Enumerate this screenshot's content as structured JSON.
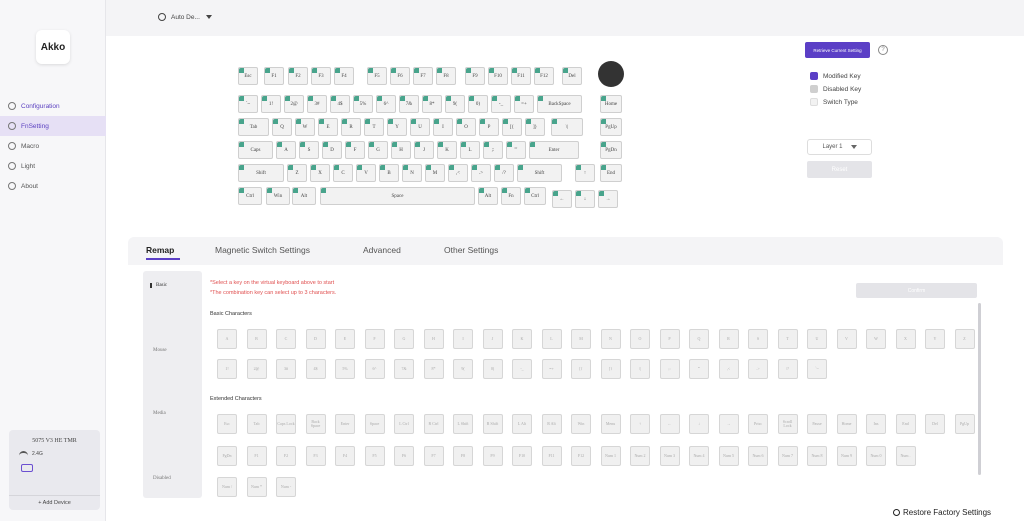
{
  "brand": "Akko",
  "mode_selector": "Auto De...",
  "nav": [
    {
      "label": "Configuration",
      "icon": "gear-icon",
      "active": false
    },
    {
      "label": "FnSetting",
      "icon": "fn-icon",
      "active": true
    },
    {
      "label": "Macro",
      "icon": "macro-icon",
      "active": false
    },
    {
      "label": "Light",
      "icon": "light-icon",
      "active": false
    },
    {
      "label": "About",
      "icon": "info-icon",
      "active": false
    }
  ],
  "device": {
    "name": "5075 V3 HE TMR",
    "connection": "2.4G",
    "add_label": "+ Add Device"
  },
  "retrieve_label": "Retrieve Current Setting",
  "help_label": "?",
  "legend": [
    {
      "label": "Modified Key",
      "color": "#5b3fc6"
    },
    {
      "label": "Disabled Key",
      "color": "#cfcfcf"
    },
    {
      "label": "Switch Type",
      "color": "#f2f2f2"
    }
  ],
  "layer": "Layer 1",
  "reset_label": "Reset",
  "tabs": [
    "Remap",
    "Magnetic Switch Settings",
    "Advanced",
    "Other Settings"
  ],
  "subnav": [
    "Basic",
    "Mouse",
    "Media",
    "Disabled"
  ],
  "hints": [
    "*Select a key on the virtual keyboard above to start",
    "*The combination key can select up to 3 characters."
  ],
  "confirm_label": "Confirm",
  "sections": {
    "basic": "Basic Characters",
    "extended": "Extended Characters"
  },
  "basic_keys_row1": [
    "A",
    "B",
    "C",
    "D",
    "E",
    "F",
    "G",
    "H",
    "I",
    "J",
    "K",
    "L",
    "M",
    "N",
    "O",
    "P",
    "Q",
    "R",
    "S",
    "T",
    "U",
    "V",
    "W",
    "X",
    "Y",
    "Z"
  ],
  "basic_keys_row2": [
    "1!",
    "2@",
    "3#",
    "4$",
    "5%",
    "6^",
    "7&",
    "8*",
    "9(",
    "0)",
    "-_",
    "=+",
    "[{",
    "]}",
    "\\|",
    ";:",
    "'\"",
    ",<",
    ".>",
    "/?",
    "`~"
  ],
  "extended_row1": [
    "Esc",
    "Tab",
    "Caps Lock",
    "Back Space",
    "Enter",
    "Space",
    "L Ctrl",
    "R Ctrl",
    "L Shift",
    "R Shift",
    "L Alt",
    "R Alt",
    "Win",
    "Menu",
    "↑",
    "←",
    "↓",
    "→",
    "Prtsc",
    "Scroll Lock",
    "Pause",
    "Home",
    "Ins",
    "End",
    "Del",
    "PgUp"
  ],
  "extended_row2": [
    "PgDn",
    "F1",
    "F2",
    "F3",
    "F4",
    "F5",
    "F6",
    "F7",
    "F8",
    "F9",
    "F10",
    "F11",
    "F12",
    "Num 1",
    "Num 2",
    "Num 3",
    "Num 4",
    "Num 5",
    "Num 6",
    "Num 7",
    "Num 8",
    "Num 9",
    "Num 0",
    "Num ."
  ],
  "extended_row3": [
    "Num /",
    "Num *",
    "Num -"
  ],
  "keyboard": {
    "row0": [
      "Esc",
      "F1",
      "F2",
      "F3",
      "F4",
      "F5",
      "F6",
      "F7",
      "F8",
      "F9",
      "F10",
      "F11",
      "F12",
      "Del"
    ],
    "row1": [
      "`~",
      "1!",
      "2@",
      "3#",
      "4$",
      "5%",
      "6^",
      "7&",
      "8*",
      "9(",
      "0)",
      "-_",
      "=+",
      "BackSpace",
      "Home"
    ],
    "row2": [
      "Tab",
      "Q",
      "W",
      "E",
      "R",
      "T",
      "Y",
      "U",
      "I",
      "O",
      "P",
      "[{",
      "]}",
      "\\|",
      "PgUp"
    ],
    "row3": [
      "Caps",
      "A",
      "S",
      "D",
      "F",
      "G",
      "H",
      "J",
      "K",
      "L",
      ";:",
      "'\"",
      "Enter",
      "PgDn"
    ],
    "row4": [
      "Shift",
      "Z",
      "X",
      "C",
      "V",
      "B",
      "N",
      "M",
      ",<",
      ".>",
      "/?",
      "Shift",
      "↑",
      "End"
    ],
    "row5": [
      "Ctrl",
      "Win",
      "Alt",
      "Space",
      "Alt",
      "Fn",
      "Ctrl",
      "←",
      "↓",
      "→"
    ]
  },
  "restore_label": "Restore Factory Settings"
}
